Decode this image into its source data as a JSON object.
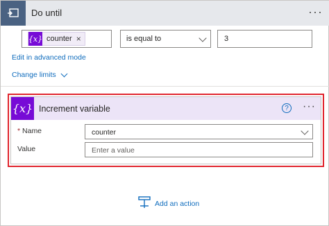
{
  "header": {
    "title": "Do until",
    "more_label": "···",
    "icon": "do-until-loop-icon",
    "color": "#4a6282"
  },
  "condition": {
    "token_icon_text": "{x}",
    "token_label": "counter",
    "token_remove": "×",
    "operator": "is equal to",
    "value": "3"
  },
  "links": {
    "advanced_mode": "Edit in advanced mode",
    "change_limits": "Change limits"
  },
  "action_card": {
    "icon_text": "{x}",
    "title": "Increment variable",
    "help_label": "?",
    "more_label": "···",
    "accent": "#770bd6",
    "fields": {
      "name_required_mark": "*",
      "name_label": "Name",
      "name_value": "counter",
      "value_label": "Value",
      "value_placeholder": "Enter a value"
    }
  },
  "add_action": {
    "label": "Add an action",
    "icon": "add-action-icon"
  }
}
